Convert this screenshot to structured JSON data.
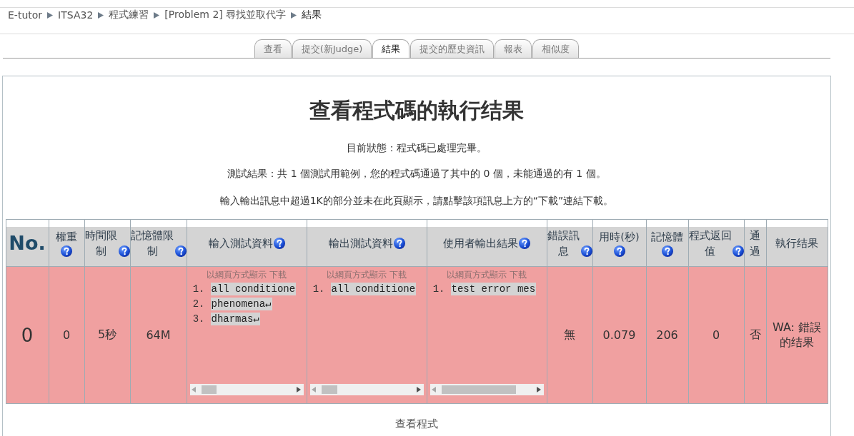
{
  "breadcrumb": [
    {
      "label": "E-tutor",
      "kind": "link"
    },
    {
      "label": "ITSA32",
      "kind": "link"
    },
    {
      "label": "程式練習",
      "kind": "link"
    },
    {
      "label": "[Problem 2] 尋找並取代字",
      "kind": "link"
    },
    {
      "label": "結果",
      "kind": "current"
    }
  ],
  "tabs": [
    {
      "label": "查看",
      "selected": false
    },
    {
      "label": "提交(新Judge)",
      "selected": false
    },
    {
      "label": "結果",
      "selected": true
    },
    {
      "label": "提交的歷史資訊",
      "selected": false
    },
    {
      "label": "報表",
      "selected": false
    },
    {
      "label": "相似度",
      "selected": false
    }
  ],
  "panel": {
    "title": "查看程式碼的執行结果",
    "messages": [
      "目前狀態：程式碼已處理完畢。",
      "測試結果：共 1 個測試用範例，您的程式碼通過了其中的 0 個，未能通過的有 1 個。",
      "輸入輸出訊息中超過1K的部分並未在此頁顯示，請點擊該項訊息上方的“下載”連結下載。"
    ],
    "table": {
      "columns": [
        {
          "label": "No.",
          "help": false
        },
        {
          "label": "權重",
          "help": true
        },
        {
          "label": "時間限制",
          "help": true
        },
        {
          "label": "記憶體限制",
          "help": true
        },
        {
          "label": "輸入測試資料",
          "help": true
        },
        {
          "label": "輸出測試資料",
          "help": true
        },
        {
          "label": "使用者輸出結果",
          "help": true
        },
        {
          "label": "錯誤訊息",
          "help": true
        },
        {
          "label": "用時(秒)",
          "help": true
        },
        {
          "label": "記憶體",
          "help": true
        },
        {
          "label": "程式返回值",
          "help": true
        },
        {
          "label": "通過",
          "help": false
        },
        {
          "label": "執行结果",
          "help": false
        }
      ],
      "rows": [
        {
          "passed": false,
          "cells": [
            {
              "kind": "text",
              "text": "0"
            },
            {
              "kind": "text",
              "text": "0"
            },
            {
              "kind": "text",
              "text": "5秒"
            },
            {
              "kind": "text",
              "text": "64M"
            },
            {
              "kind": "io",
              "links": [
                "以網頁方式顯示",
                "下載"
              ],
              "lines": [
                {
                  "number": "1.",
                  "text": "all conditione"
                },
                {
                  "number": "2.",
                  "text": "phenomena↵"
                },
                {
                  "number": "3.",
                  "text": "dharmas↵"
                }
              ]
            },
            {
              "kind": "io",
              "links": [
                "以網頁方式顯示",
                "下載"
              ],
              "lines": [
                {
                  "number": "1.",
                  "text": "all conditione"
                }
              ]
            },
            {
              "kind": "io",
              "links": [
                "以網頁方式顯示",
                "下載"
              ],
              "lines": [
                {
                  "number": "1.",
                  "text": "test error mes"
                }
              ]
            },
            {
              "kind": "text",
              "text": "無"
            },
            {
              "kind": "text",
              "text": "0.079"
            },
            {
              "kind": "text",
              "text": "206"
            },
            {
              "kind": "text",
              "text": "0"
            },
            {
              "kind": "text",
              "text": "否"
            },
            {
              "kind": "text",
              "text": "WA: 錯誤的结果"
            }
          ]
        }
      ]
    },
    "footer_link": "查看程式"
  }
}
